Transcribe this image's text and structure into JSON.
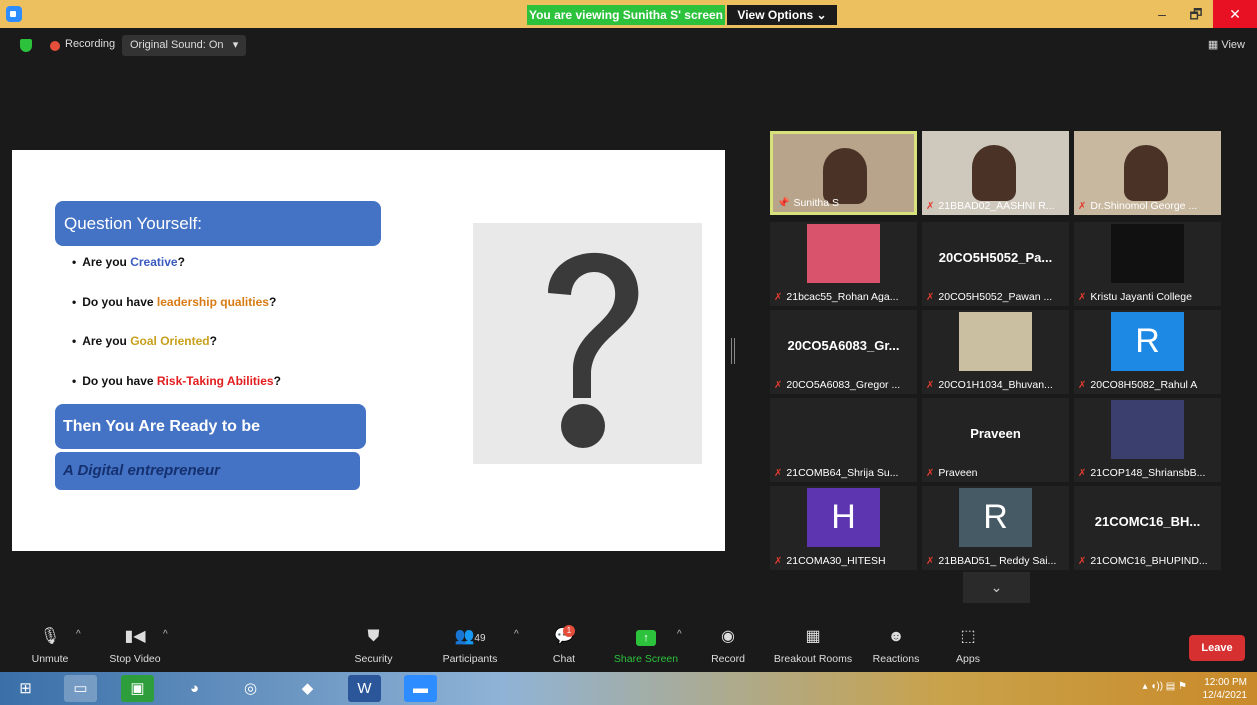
{
  "titlebar": {
    "viewing": "You are viewing Sunitha S' screen",
    "view_options": "View Options ⌄",
    "minimize": "–",
    "restore": "🗗",
    "close": "✕"
  },
  "topbar": {
    "recording": "Recording",
    "sound": "Original Sound: On",
    "sound_caret": "▾",
    "view": "View"
  },
  "slide": {
    "question": "Question Yourself:",
    "bullets": [
      {
        "pre": "Are you ",
        "hl": "Creative",
        "post": "?"
      },
      {
        "pre": "Do you have ",
        "hl": "leadership qualities",
        "post": "?"
      },
      {
        "pre": "Are you ",
        "hl": "Goal Oriented",
        "post": "?"
      },
      {
        "pre": "Do you have ",
        "hl": "Risk-Taking Abilities",
        "post": "?"
      }
    ],
    "ready": "Then You Are Ready to be",
    "entrepreneur": "A Digital entrepreneur"
  },
  "gallery": [
    {
      "name": "Sunitha S",
      "type": "video",
      "bg": "#b8a48a",
      "pin": true
    },
    {
      "name": "21BBAD02_AASHNI R...",
      "type": "video",
      "bg": "#cfc8bd"
    },
    {
      "name": "Dr.Shinomol George ...",
      "type": "video",
      "bg": "#c9b8a0"
    },
    {
      "name": "21bcac55_Rohan Aga...",
      "type": "image",
      "bg": "#d9536d"
    },
    {
      "name": "20CO5H5052_Pawan ...",
      "type": "text",
      "big": "20CO5H5052_Pa..."
    },
    {
      "name": "Kristu Jayanti College",
      "type": "image",
      "bg": "#111111"
    },
    {
      "name": "20CO5A6083_Gregor ...",
      "type": "text",
      "big": "20CO5A6083_Gr..."
    },
    {
      "name": "20CO1H1034_Bhuvan...",
      "type": "image",
      "bg": "#cbbfa2"
    },
    {
      "name": "20CO8H5082_Rahul A",
      "type": "avatar",
      "letter": "R",
      "bg": "#1e88e5"
    },
    {
      "name": "21COMB64_Shrija Su...",
      "type": "blank"
    },
    {
      "name": "Praveen",
      "type": "text",
      "big": "Praveen"
    },
    {
      "name": "21COP148_ShriansbB...",
      "type": "image",
      "bg": "#3b3f6e"
    },
    {
      "name": "21COMA30_HITESH",
      "type": "avatar",
      "letter": "H",
      "bg": "#5e35b1"
    },
    {
      "name": "21BBAD51_ Reddy Sai...",
      "type": "avatar",
      "letter": "R",
      "bg": "#455a64"
    },
    {
      "name": "21COMC16_BHUPIND...",
      "type": "text",
      "big": "21COMC16_BH..."
    }
  ],
  "gallery_more": "⌄",
  "toolbar": {
    "unmute": "Unmute",
    "stop_video": "Stop Video",
    "security": "Security",
    "participants": "Participants",
    "participants_count": "49",
    "chat": "Chat",
    "chat_badge": "1",
    "share": "Share Screen",
    "record": "Record",
    "breakout": "Breakout Rooms",
    "reactions": "Reactions",
    "apps": "Apps",
    "leave": "Leave"
  },
  "taskbar": {
    "time": "12:00 PM",
    "date": "12/4/2021"
  }
}
